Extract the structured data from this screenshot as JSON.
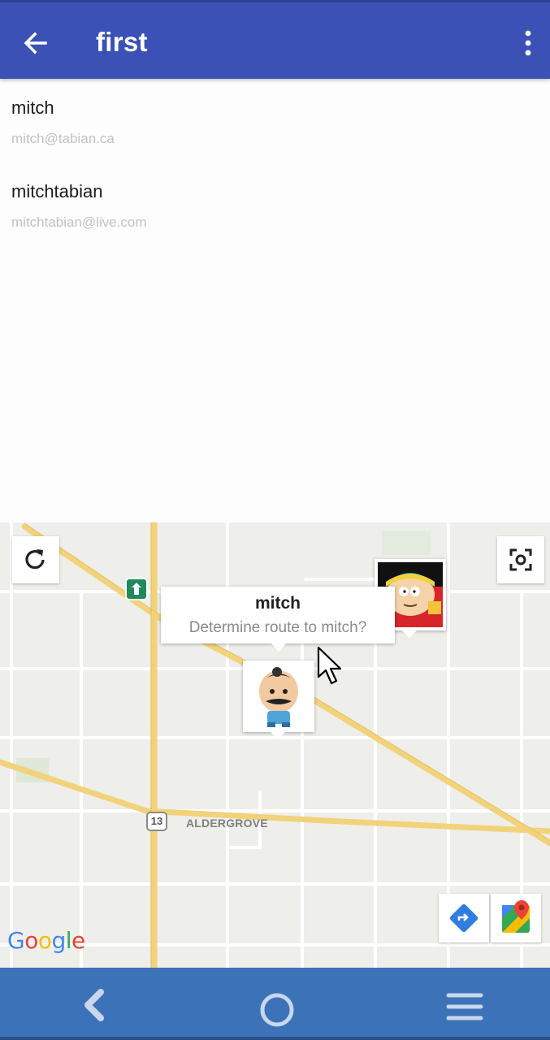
{
  "app_bar": {
    "title": "first",
    "back_icon": "arrow-back-icon",
    "overflow_icon": "more-vert-icon",
    "background_color": "#3b51b5"
  },
  "users": [
    {
      "name": "mitch",
      "email": "mitch@tabian.ca"
    },
    {
      "name": "mitchtabian",
      "email": "mitchtabian@live.com"
    }
  ],
  "map": {
    "info_window": {
      "title": "mitch",
      "snippet": "Determine route to mitch?"
    },
    "town_label": "ALDERGROVE",
    "highway_label": "13",
    "attribution": {
      "letters": [
        "G",
        "o",
        "o",
        "g",
        "l",
        "e"
      ],
      "colors": [
        "#4285f4",
        "#ea4335",
        "#fbbc05",
        "#4285f4",
        "#34a853",
        "#ea4335"
      ]
    },
    "buttons": {
      "reset": "refresh-icon",
      "recenter": "center-focus-icon",
      "directions": "directions-icon",
      "open_maps": "google-maps-icon"
    },
    "markers": [
      "ike-avatar-marker",
      "cartman-avatar-marker"
    ],
    "road_color": "#f2d27a",
    "street_color": "#ffffff",
    "land_color": "#eeeeea"
  },
  "navbar": {
    "back": "nav-back-icon",
    "home": "nav-home-icon",
    "menu": "nav-menu-icon",
    "background_color": "#3c72b8"
  }
}
